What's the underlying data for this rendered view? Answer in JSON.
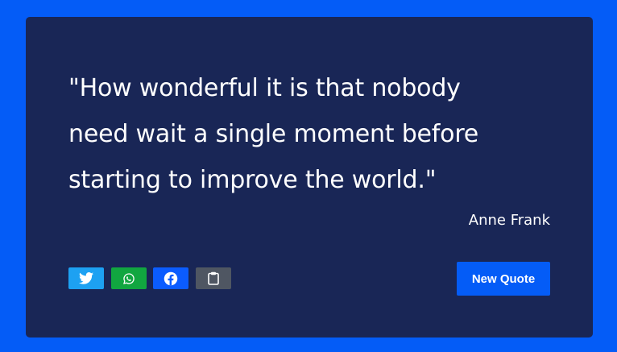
{
  "quote": {
    "text": "\"How wonderful it is that nobody need wait a single moment before starting to improve the world.\"",
    "author": "Anne Frank"
  },
  "share_buttons": [
    {
      "icon": "twitter-icon",
      "color": "#1da1f2"
    },
    {
      "icon": "whatsapp-icon",
      "color": "#11a640"
    },
    {
      "icon": "facebook-icon",
      "color": "#0b5cff"
    },
    {
      "icon": "clipboard-icon",
      "color": "#4f5662"
    }
  ],
  "actions": {
    "new_quote_label": "New Quote"
  },
  "colors": {
    "page_background": "#045cf7",
    "card_background": "#192656",
    "text": "#ffffff",
    "accent": "#045cf7"
  }
}
